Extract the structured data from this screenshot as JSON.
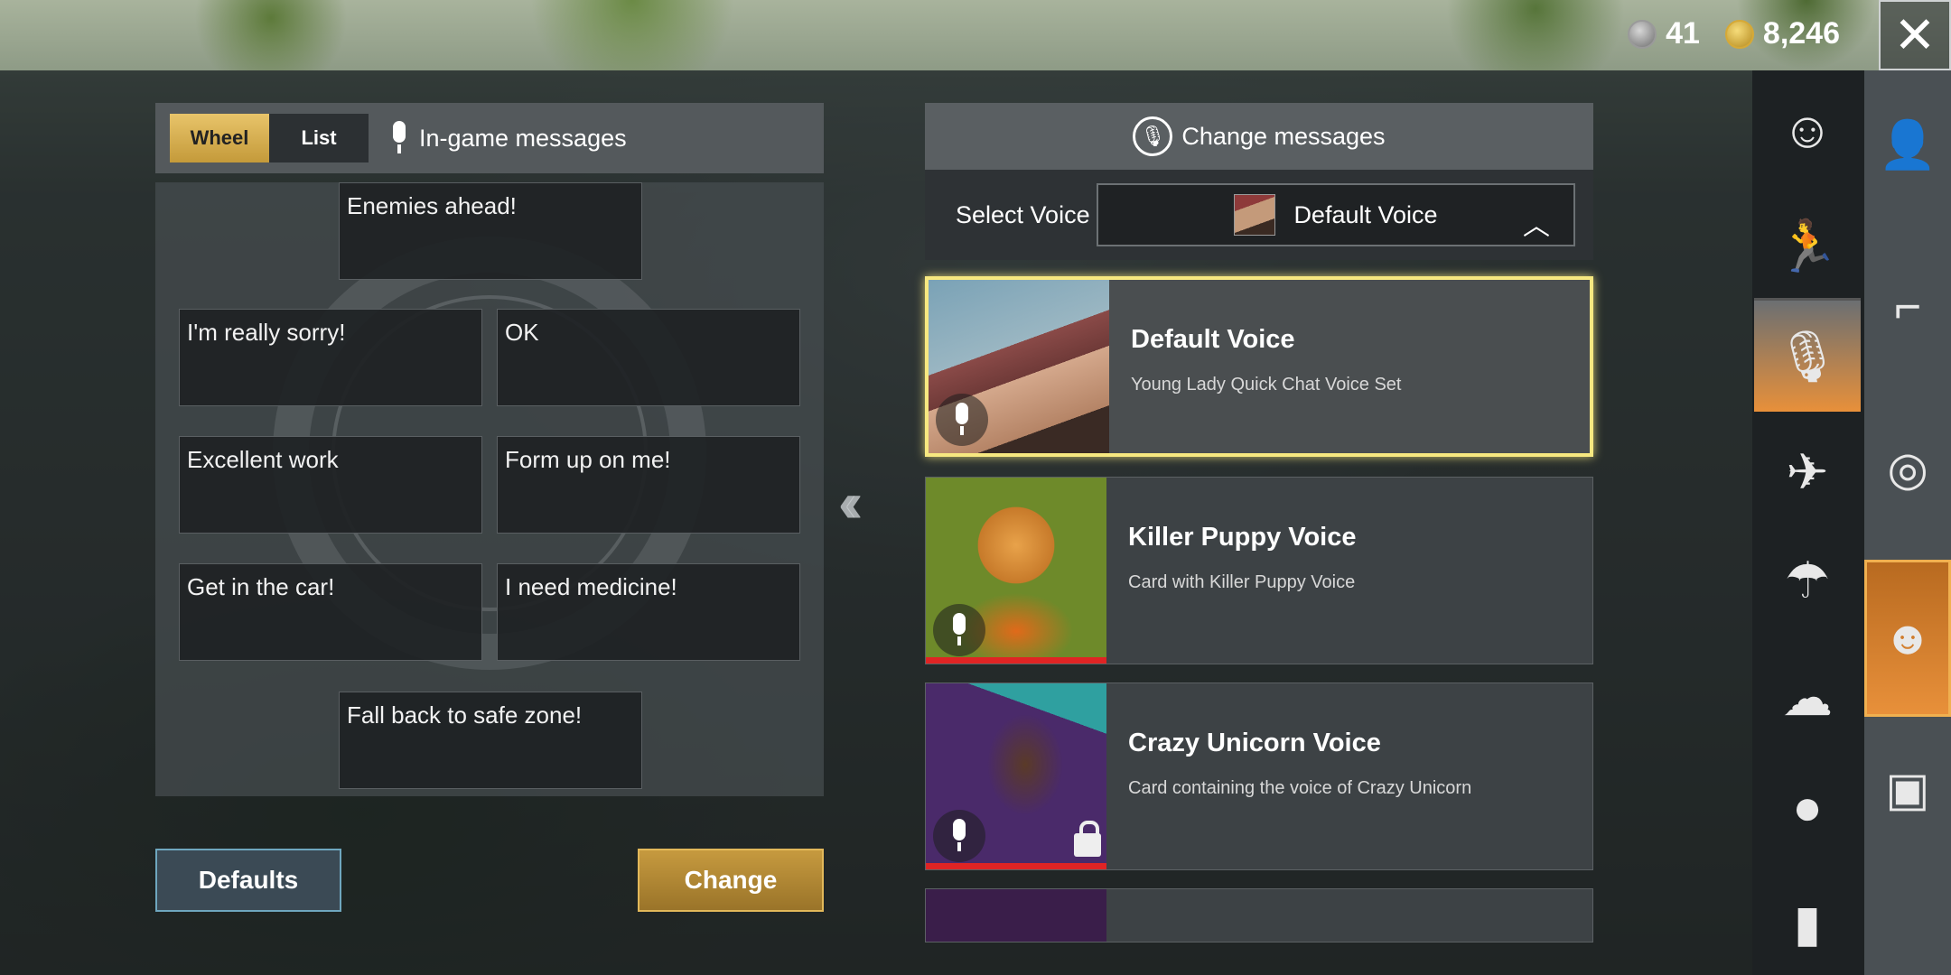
{
  "currency": {
    "silver_value": "41",
    "gold_value": "8,246"
  },
  "tabs": [
    {
      "label": "Wheel",
      "active": true
    },
    {
      "label": "List",
      "active": false
    }
  ],
  "left_title": "In-game messages",
  "messages": [
    "Enemies ahead!",
    "I'm really sorry!",
    "OK",
    "Excellent work",
    "Form up on me!",
    "Get in the car!",
    "I need medicine!",
    "Fall back to safe zone!"
  ],
  "buttons": {
    "defaults": "Defaults",
    "change": "Change"
  },
  "right_title": "Change messages",
  "select_voice": {
    "label": "Select Voice",
    "selected": "Default Voice"
  },
  "voices": [
    {
      "title": "Default Voice",
      "desc": "Young Lady Quick Chat Voice Set",
      "selected": true,
      "locked": false
    },
    {
      "title": "Killer Puppy Voice",
      "desc": "Card with Killer Puppy Voice",
      "selected": false,
      "locked": false
    },
    {
      "title": "Crazy Unicorn Voice",
      "desc": "Card containing the voice of Crazy Unicorn",
      "selected": false,
      "locked": true
    }
  ],
  "icons": {
    "close": "close-icon",
    "categories": [
      "emote-icon",
      "dance-icon",
      "voice-icon",
      "plane-icon",
      "parachute-icon",
      "smoke-icon",
      "grenade-icon",
      "spray-icon"
    ],
    "categories_secondary": [
      "character-icon",
      "pistol-icon",
      "steering-wheel-icon",
      "quick-chat-icon",
      "crate-icon"
    ]
  },
  "colors": {
    "accent_gold": "#e8c46a",
    "selected_border": "#f7e880",
    "active_orange": "#e8903a",
    "locked_bar": "#e02424"
  }
}
